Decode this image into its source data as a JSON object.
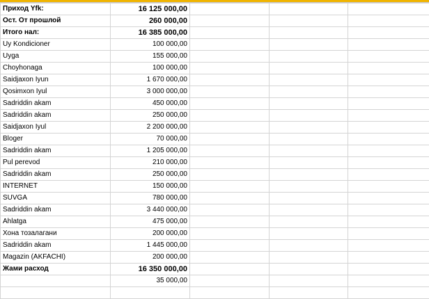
{
  "rows": [
    {
      "label": "Приход Yfk:",
      "amount": "16 125 000,00",
      "bold": true
    },
    {
      "label": "Ост. От прошлой",
      "amount": "260 000,00",
      "bold": true
    },
    {
      "label": "Итого нал:",
      "amount": "16 385 000,00",
      "bold": true
    },
    {
      "label": "Uy Kondicioner",
      "amount": "100 000,00",
      "bold": false
    },
    {
      "label": "Uyga",
      "amount": "155 000,00",
      "bold": false
    },
    {
      "label": "Choyhonaga",
      "amount": "100 000,00",
      "bold": false
    },
    {
      "label": "Saidjaxon Iyun",
      "amount": "1 670 000,00",
      "bold": false
    },
    {
      "label": "Qosimxon Iyul",
      "amount": "3 000 000,00",
      "bold": false
    },
    {
      "label": "Sadriddin akam",
      "amount": "450 000,00",
      "bold": false
    },
    {
      "label": "Sadriddin akam",
      "amount": "250 000,00",
      "bold": false
    },
    {
      "label": "Saidjaxon Iyul",
      "amount": "2 200 000,00",
      "bold": false
    },
    {
      "label": "Bloger",
      "amount": "70 000,00",
      "bold": false
    },
    {
      "label": "Sadriddin akam",
      "amount": "1 205 000,00",
      "bold": false
    },
    {
      "label": "Pul perevod",
      "amount": "210 000,00",
      "bold": false
    },
    {
      "label": "Sadriddin akam",
      "amount": "250 000,00",
      "bold": false
    },
    {
      "label": "INTERNET",
      "amount": "150 000,00",
      "bold": false
    },
    {
      "label": "SUVGA",
      "amount": "780 000,00",
      "bold": false
    },
    {
      "label": "Sadriddin akam",
      "amount": "3 440 000,00",
      "bold": false
    },
    {
      "label": "Ahlatga",
      "amount": "475 000,00",
      "bold": false
    },
    {
      "label": "Хона тозалагани",
      "amount": "200 000,00",
      "bold": false
    },
    {
      "label": "Sadriddin akam",
      "amount": "1 445 000,00",
      "bold": false
    },
    {
      "label": "Magazin (AKFACHI)",
      "amount": "200 000,00",
      "bold": false
    },
    {
      "label": "Жами расход",
      "amount": "16 350 000,00",
      "bold": true
    },
    {
      "label": "",
      "amount": "35 000,00",
      "bold": false
    },
    {
      "label": "",
      "amount": "",
      "bold": false
    }
  ],
  "colors": {
    "header_accent": "#f0b400",
    "gridline": "#d4d4d4"
  }
}
